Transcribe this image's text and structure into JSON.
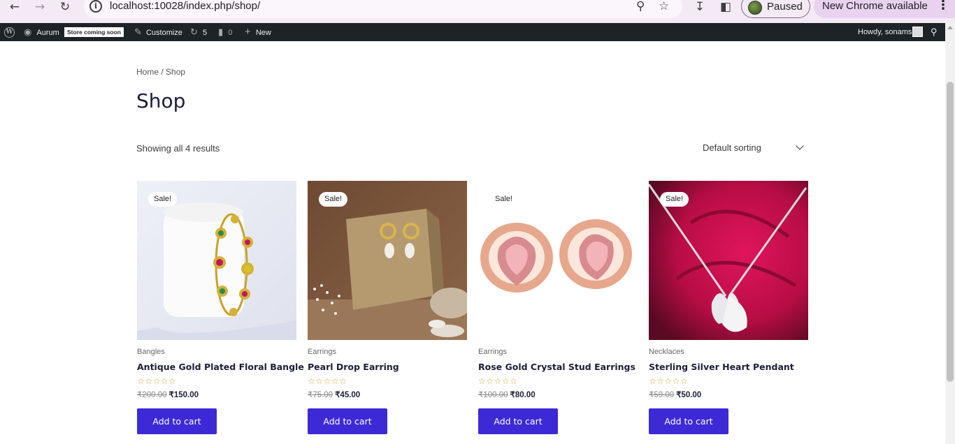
{
  "browser": {
    "url": "localhost:10028/index.php/shop/",
    "profile_status": "Paused",
    "update_label": "New Chrome available",
    "icons": [
      "back-icon",
      "forward-icon",
      "reload-icon",
      "site-info-icon",
      "zoom-icon",
      "bookmark-star-icon",
      "download-icon",
      "side-panel-icon",
      "menu-dots-icon"
    ]
  },
  "adminbar": {
    "site_name": "Aurum",
    "store_badge": "Store coming soon",
    "customize": "Customize",
    "updates_count": "5",
    "comments_count": "0",
    "new_label": "New",
    "howdy": "Howdy, sonams"
  },
  "page": {
    "breadcrumb": "Home / Shop",
    "title": "Shop",
    "result_count": "Showing all 4 results",
    "sorting": "Default sorting"
  },
  "products": [
    {
      "sale": "Sale!",
      "category": "Bangles",
      "name": "Antique Gold Plated Floral Bangle",
      "stars": "☆☆☆☆☆",
      "old_price": "₹200.00",
      "price": "₹150.00",
      "button": "Add to cart"
    },
    {
      "sale": "Sale!",
      "category": "Earrings",
      "name": "Pearl Drop Earring",
      "stars": "☆☆☆☆☆",
      "old_price": "₹75.00",
      "price": "₹45.00",
      "button": "Add to cart"
    },
    {
      "sale": "Sale!",
      "category": "Earrings",
      "name": "Rose Gold Crystal Stud Earrings",
      "stars": "☆☆☆☆☆",
      "old_price": "₹100.00",
      "price": "₹80.00",
      "button": "Add to cart"
    },
    {
      "sale": "Sale!",
      "category": "Necklaces",
      "name": "Sterling Silver Heart Pendant",
      "stars": "☆☆☆☆☆",
      "old_price": "₹59.00",
      "price": "₹50.00",
      "button": "Add to cart"
    }
  ],
  "colors": {
    "button": "#3d2ad6",
    "adminbar": "#1d2327",
    "chrome": "#f4eaf6"
  }
}
